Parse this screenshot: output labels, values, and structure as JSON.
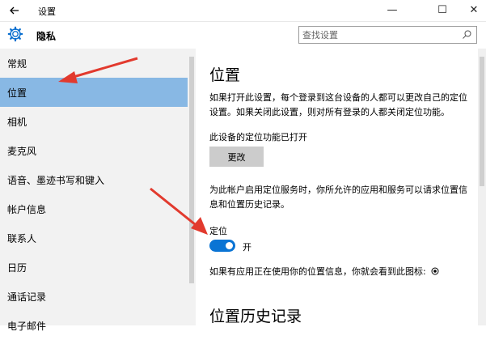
{
  "window": {
    "title": "设置",
    "back_icon": "back-arrow-icon",
    "minimize_glyph": "—",
    "maximize_glyph": "☐",
    "close_glyph": "✕"
  },
  "header": {
    "title": "隐私",
    "icon": "gear-icon"
  },
  "search": {
    "placeholder": "查找设置",
    "value": ""
  },
  "sidebar": {
    "items": [
      {
        "label": "常规"
      },
      {
        "label": "位置"
      },
      {
        "label": "相机"
      },
      {
        "label": "麦克风"
      },
      {
        "label": "语音、墨迹书写和键入"
      },
      {
        "label": "帐户信息"
      },
      {
        "label": "联系人"
      },
      {
        "label": "日历"
      },
      {
        "label": "通话记录"
      },
      {
        "label": "电子邮件"
      }
    ],
    "selected_index": 1
  },
  "main": {
    "title": "位置",
    "description": "如果打开此设置，每个登录到这台设备的人都可以更改自己的定位设置。如果关闭此设置，则对所有登录的人都关闭定位功能。",
    "device_status": "此设备的定位功能已打开",
    "change_button": "更改",
    "account_description": "为此帐户启用定位服务时，你所允许的应用和服务可以请求位置信息和位置历史记录。",
    "location_label": "定位",
    "toggle_state": "开",
    "toggle_on": true,
    "icon_hint": "如果有应用正在使用你的位置信息，你就会看到此图标:",
    "icon_name": "location-in-use-icon",
    "history_title": "位置历史记录"
  },
  "colors": {
    "selected_bg": "#88b8e4",
    "accent": "#0a74d4",
    "annotation_arrow": "#e23a2e"
  }
}
